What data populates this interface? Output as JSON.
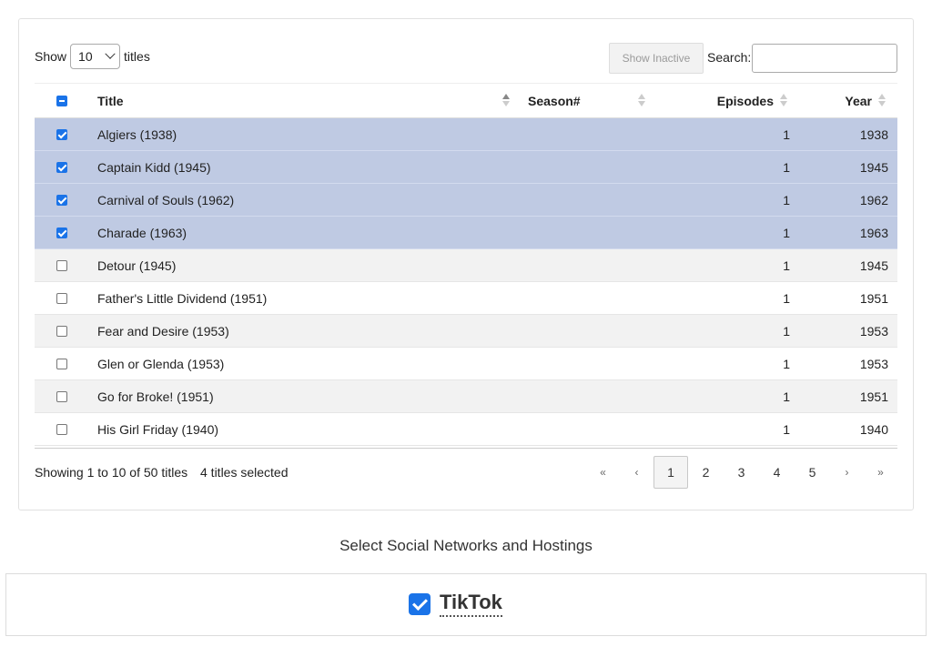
{
  "controls": {
    "show_label": "Show",
    "length_value": "10",
    "titles_label": "titles",
    "show_inactive_label": "Show Inactive",
    "search_label": "Search:",
    "search_value": ""
  },
  "table": {
    "columns": {
      "title": "Title",
      "season": "Season#",
      "episodes": "Episodes",
      "year": "Year"
    },
    "rows": [
      {
        "title": "Algiers (1938)",
        "season": "",
        "episodes": "1",
        "year": "1938",
        "selected": true
      },
      {
        "title": "Captain Kidd (1945)",
        "season": "",
        "episodes": "1",
        "year": "1945",
        "selected": true
      },
      {
        "title": "Carnival of Souls (1962)",
        "season": "",
        "episodes": "1",
        "year": "1962",
        "selected": true
      },
      {
        "title": "Charade (1963)",
        "season": "",
        "episodes": "1",
        "year": "1963",
        "selected": true
      },
      {
        "title": "Detour (1945)",
        "season": "",
        "episodes": "1",
        "year": "1945",
        "selected": false
      },
      {
        "title": "Father's Little Dividend (1951)",
        "season": "",
        "episodes": "1",
        "year": "1951",
        "selected": false
      },
      {
        "title": "Fear and Desire (1953)",
        "season": "",
        "episodes": "1",
        "year": "1953",
        "selected": false
      },
      {
        "title": "Glen or Glenda (1953)",
        "season": "",
        "episodes": "1",
        "year": "1953",
        "selected": false
      },
      {
        "title": "Go for Broke! (1951)",
        "season": "",
        "episodes": "1",
        "year": "1951",
        "selected": false
      },
      {
        "title": "His Girl Friday (1940)",
        "season": "",
        "episodes": "1",
        "year": "1940",
        "selected": false
      }
    ]
  },
  "footer": {
    "info": "Showing 1 to 10 of 50 titles",
    "selected_info": "4 titles selected",
    "pager": {
      "first": "«",
      "prev": "‹",
      "pages": [
        "1",
        "2",
        "3",
        "4",
        "5"
      ],
      "current": "1",
      "next": "›",
      "last": "»"
    }
  },
  "social": {
    "heading": "Select Social Networks and Hostings",
    "networks": [
      {
        "label": "TikTok",
        "checked": true
      }
    ]
  },
  "colors": {
    "selected_row": "#bfcae3",
    "checkbox_accent": "#1a73e8"
  }
}
